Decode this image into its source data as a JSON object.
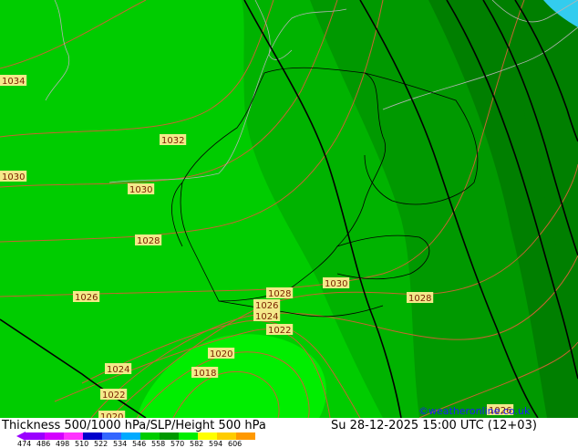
{
  "map": {
    "pressure_labels": [
      "1034",
      "1032",
      "1030",
      "1030",
      "1028",
      "1026",
      "1028",
      "1026",
      "1024",
      "1022",
      "1030",
      "1028",
      "1020",
      "1018",
      "1024",
      "1022",
      "1020",
      "1026"
    ],
    "colors": {
      "base_green": "#00cc00",
      "mid_green": "#00b300",
      "dark_green": "#009900",
      "darker_green": "#007f00",
      "bright_green": "#00ee00",
      "isobar": "#c86432",
      "thickness_line": "#000000",
      "border": "#000000",
      "coast": "#b4b4b4",
      "sea": "#33ccee"
    }
  },
  "footer": {
    "title": "Thickness 500/1000 hPa/SLP/Height 500 hPa",
    "datetime": "Su 28-12-2025 15:00 UTC (12+03)",
    "credit": "©weatheronline.co.uk",
    "scale_values": [
      "474",
      "486",
      "498",
      "510",
      "522",
      "534",
      "546",
      "558",
      "570",
      "582",
      "594",
      "606"
    ],
    "scale_colors": [
      "#9a00ff",
      "#d400ff",
      "#ff33ff",
      "#0000cc",
      "#3366ff",
      "#00aaff",
      "#00cc00",
      "#009900",
      "#00ee00",
      "#ffff00",
      "#ffcc00",
      "#ff9900"
    ]
  }
}
